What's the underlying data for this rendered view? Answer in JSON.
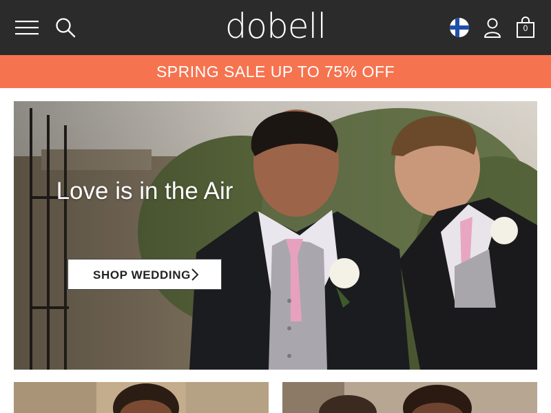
{
  "header": {
    "brand": "dobell",
    "menu_icon": "hamburger-menu-icon",
    "search_icon": "search-icon",
    "region_icon": "finland-flag-icon",
    "account_icon": "user-account-icon",
    "bag_icon": "shopping-bag-icon",
    "bag_count": "0"
  },
  "promo": {
    "text": "SPRING SALE UP TO 75% OFF",
    "background": "#f6734f"
  },
  "hero": {
    "title": "Love is in the Air",
    "cta_label": "SHOP WEDDING",
    "cta_icon": "chevron-right-icon"
  },
  "colors": {
    "header_bg": "#2b2b2b",
    "text_on_dark": "#ffffff",
    "accent": "#f6734f"
  }
}
